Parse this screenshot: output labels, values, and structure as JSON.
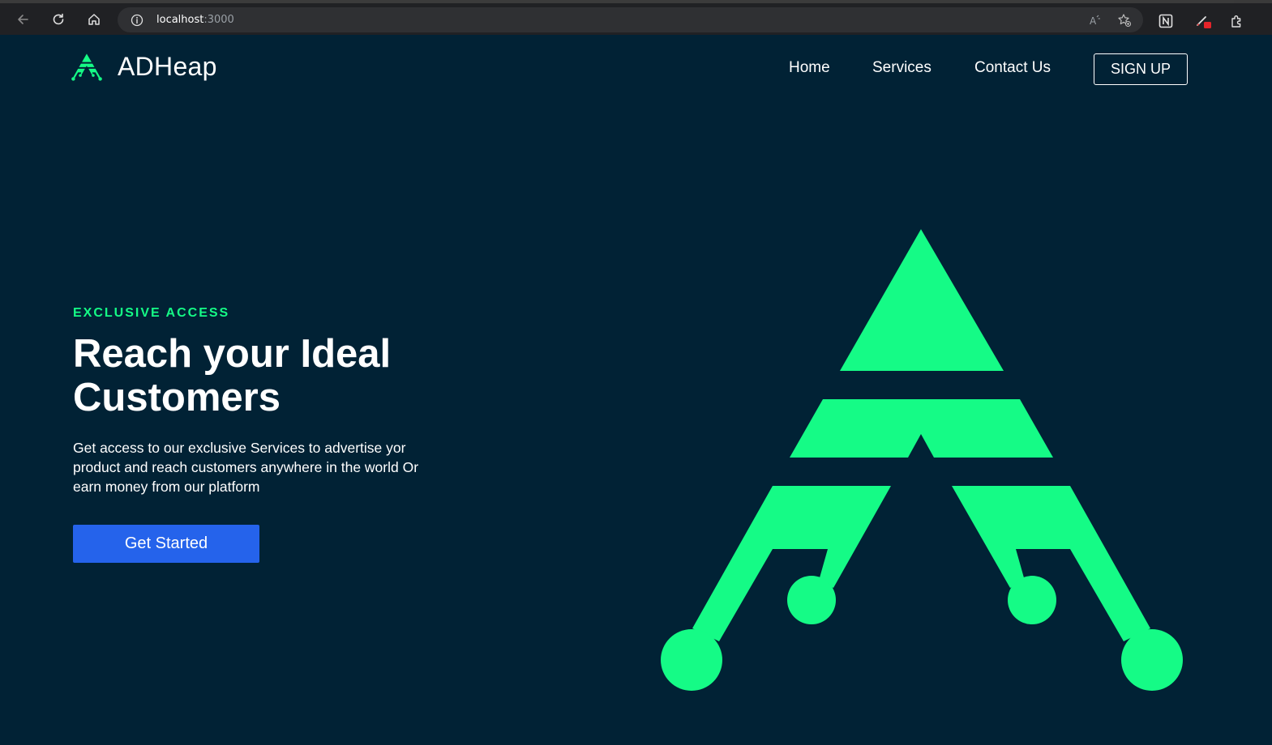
{
  "browser": {
    "url_host": "localhost",
    "url_port": ":3000",
    "icons": {
      "back": "back-arrow-icon",
      "reload": "reload-icon",
      "home": "home-icon",
      "site_info": "info-icon",
      "read_aloud": "read-aloud-icon",
      "favorites": "add-favorite-icon",
      "notion": "notion-icon",
      "extension_badge": "pen-extension-icon",
      "extensions": "puzzle-icon"
    }
  },
  "header": {
    "brand": "ADHeap",
    "nav": [
      {
        "label": "Home"
      },
      {
        "label": "Services"
      },
      {
        "label": "Contact Us"
      }
    ],
    "signup_label": "SIGN UP"
  },
  "hero": {
    "eyebrow": "EXCLUSIVE ACCESS",
    "headline_line1": "Reach your Ideal",
    "headline_line2": "Customers",
    "description": "Get access to our exclusive Services to advertise yor product and reach customers anywhere in the world Or earn money from our platform",
    "cta_label": "Get Started"
  },
  "colors": {
    "background": "#012235",
    "accent_green": "#15fb86",
    "cta_blue": "#2563eb",
    "text": "#ffffff"
  }
}
